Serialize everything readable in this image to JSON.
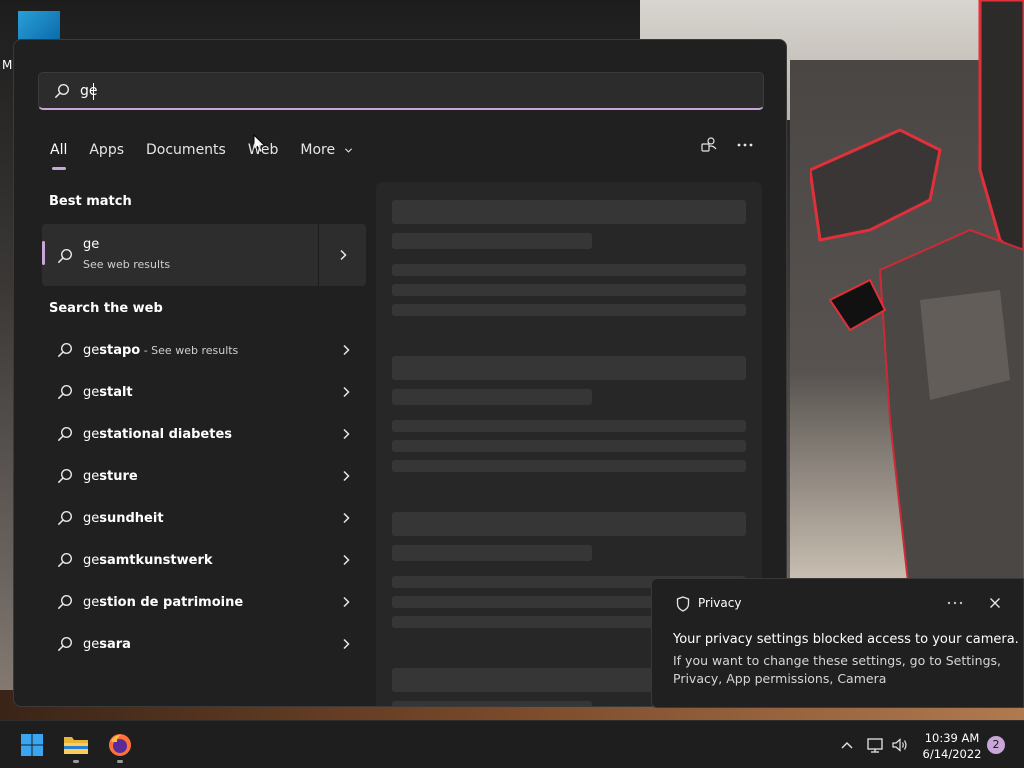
{
  "desktop": {
    "icon_letter": "M"
  },
  "search": {
    "query": "ge",
    "tabs": [
      {
        "label": "All",
        "active": true
      },
      {
        "label": "Apps",
        "active": false
      },
      {
        "label": "Documents",
        "active": false
      },
      {
        "label": "Web",
        "active": false
      },
      {
        "label": "More",
        "active": false
      }
    ],
    "best_match_heading": "Best match",
    "best_match": {
      "title": "ge",
      "subtitle": "See web results"
    },
    "web_heading": "Search the web",
    "web_results": [
      {
        "prefix": "ge",
        "bold": "stapo",
        "suffix": " - See web results"
      },
      {
        "prefix": "ge",
        "bold": "stalt",
        "suffix": ""
      },
      {
        "prefix": "ge",
        "bold": "stational diabetes",
        "suffix": ""
      },
      {
        "prefix": "ge",
        "bold": "sture",
        "suffix": ""
      },
      {
        "prefix": "ge",
        "bold": "sundheit",
        "suffix": ""
      },
      {
        "prefix": "ge",
        "bold": "samtkunstwerk",
        "suffix": ""
      },
      {
        "prefix": "ge",
        "bold": "stion de patrimoine",
        "suffix": ""
      },
      {
        "prefix": "ge",
        "bold": "sara",
        "suffix": ""
      }
    ],
    "accent_color": "#c8a6d8"
  },
  "toast": {
    "app": "Privacy",
    "title": "Your privacy settings blocked access to your camera.",
    "body": "If you want to change these settings, go to Settings, Privacy, App permissions, Camera"
  },
  "taskbar": {
    "pinned": [
      {
        "name": "windows-start",
        "icon": "windows-logo-icon"
      },
      {
        "name": "file-explorer",
        "icon": "folder-icon"
      },
      {
        "name": "firefox",
        "icon": "firefox-icon"
      }
    ],
    "time": "10:39 AM",
    "date": "6/14/2022",
    "notification_count": "2"
  }
}
